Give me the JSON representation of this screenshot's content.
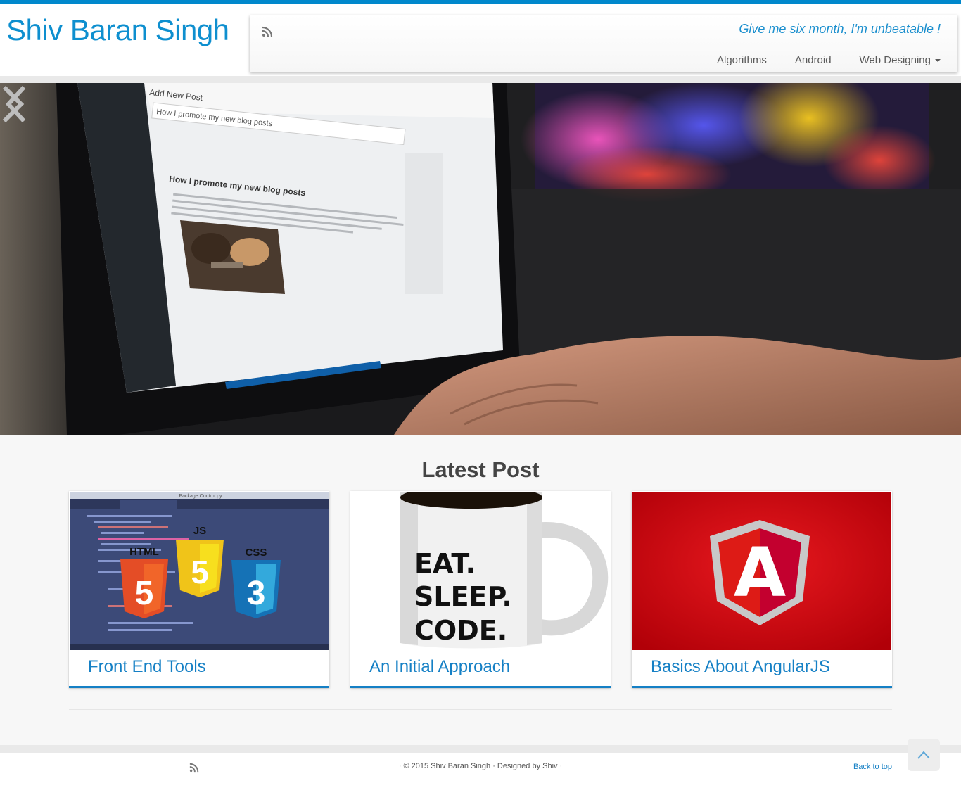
{
  "header": {
    "site_title": "Shiv Baran Singh",
    "tagline": "Give me six month, I'm unbeatable !",
    "menu": [
      {
        "label": "Algorithms"
      },
      {
        "label": "Android"
      },
      {
        "label": "Web Designing"
      }
    ]
  },
  "slider": {
    "laptop_screen": {
      "title": "Add New Post",
      "post_title": "How I promote my new blog posts",
      "heading": "How I promote my new blog posts"
    }
  },
  "latest": {
    "title": "Latest Post",
    "cards": [
      {
        "title": "Front End Tools",
        "image_labels": [
          "HTML",
          "JS",
          "CSS",
          "5",
          "5",
          "3"
        ],
        "window_title": "Package Control.py"
      },
      {
        "title": "An Initial Approach",
        "image_labels": [
          "EAT.",
          "SLEEP.",
          "CODE."
        ]
      },
      {
        "title": "Basics About AngularJS",
        "image_labels": [
          "A"
        ]
      }
    ]
  },
  "footer": {
    "copyright": "· © 2015 Shiv Baran Singh · Designed by Shiv ·",
    "back_to_top": "Back to top"
  },
  "colors": {
    "accent": "#0088cc",
    "link": "#1580c5",
    "background": "#f7f7f7"
  },
  "icons": [
    "rss-icon",
    "chevron-left-icon",
    "chevron-right-icon",
    "chevron-up-icon",
    "caret-down-icon"
  ]
}
